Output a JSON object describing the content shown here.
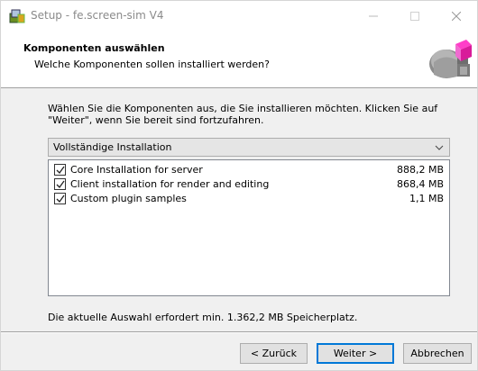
{
  "window": {
    "title": "Setup - fe.screen-sim V4",
    "icon": "setup-installer-icon",
    "controls": {
      "minimize": "minimize-icon",
      "maximize": "maximize-icon",
      "close": "close-icon"
    }
  },
  "header": {
    "title": "Komponenten auswählen",
    "subtitle": "Welche Komponenten sollen installiert werden?",
    "graphic": "installer-box-graphic"
  },
  "main": {
    "description": "Wählen Sie die Komponenten aus, die Sie installieren möchten. Klicken Sie auf \"Weiter\", wenn Sie bereit sind fortzufahren.",
    "install_type": {
      "selected": "Vollständige Installation"
    },
    "components": [
      {
        "label": "Core Installation for server",
        "size": "888,2 MB",
        "checked": true
      },
      {
        "label": "Client installation for render and editing",
        "size": "868,4 MB",
        "checked": true
      },
      {
        "label": "Custom plugin samples",
        "size": "1,1 MB",
        "checked": true
      }
    ],
    "space_required": "Die aktuelle Auswahl erfordert min. 1.362,2 MB Speicherplatz."
  },
  "buttons": {
    "back": "< Zurück",
    "next": "Weiter >",
    "cancel": "Abbrechen"
  },
  "colors": {
    "accent": "#0078d7",
    "window_bg": "#f0f0f0",
    "header_bg": "#ffffff"
  }
}
